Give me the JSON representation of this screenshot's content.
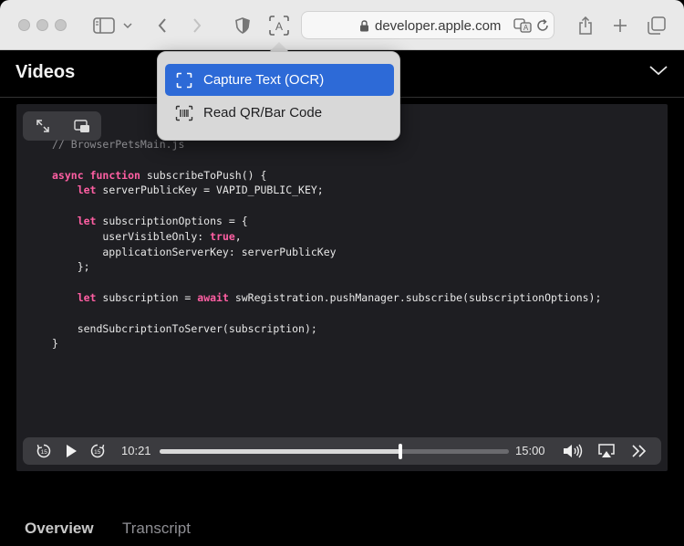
{
  "toolbar": {
    "url": "developer.apple.com"
  },
  "icons": {
    "sidebar": "sidebar-icon",
    "back": "chevron-left-icon",
    "forward": "chevron-right-icon",
    "shield": "shield-icon",
    "ocr": "live-text-icon",
    "lock": "lock-icon",
    "translate": "translate-icon",
    "reload": "reload-icon",
    "share": "share-icon",
    "new_tab": "plus-icon",
    "tabs": "tab-overview-icon"
  },
  "page": {
    "title": "Videos"
  },
  "code_lines": [
    {
      "parts": [
        {
          "t": "// BrowserPetsMain.js",
          "c": "cm"
        }
      ]
    },
    {
      "parts": [
        {
          "t": "",
          "c": ""
        }
      ]
    },
    {
      "parts": [
        {
          "t": "async",
          "c": "kw"
        },
        {
          "t": " ",
          "c": ""
        },
        {
          "t": "function",
          "c": "kw"
        },
        {
          "t": " subscribeToPush() {",
          "c": ""
        }
      ]
    },
    {
      "parts": [
        {
          "t": "    ",
          "c": ""
        },
        {
          "t": "let",
          "c": "kw"
        },
        {
          "t": " serverPublicKey = VAPID_PUBLIC_KEY;",
          "c": ""
        }
      ]
    },
    {
      "parts": [
        {
          "t": "",
          "c": ""
        }
      ]
    },
    {
      "parts": [
        {
          "t": "    ",
          "c": ""
        },
        {
          "t": "let",
          "c": "kw"
        },
        {
          "t": " subscriptionOptions = {",
          "c": ""
        }
      ]
    },
    {
      "parts": [
        {
          "t": "        userVisibleOnly: ",
          "c": ""
        },
        {
          "t": "true",
          "c": "kw"
        },
        {
          "t": ",",
          "c": ""
        }
      ]
    },
    {
      "parts": [
        {
          "t": "        applicationServerKey: serverPublicKey",
          "c": ""
        }
      ]
    },
    {
      "parts": [
        {
          "t": "    };",
          "c": ""
        }
      ]
    },
    {
      "parts": [
        {
          "t": "",
          "c": ""
        }
      ]
    },
    {
      "parts": [
        {
          "t": "    ",
          "c": ""
        },
        {
          "t": "let",
          "c": "kw"
        },
        {
          "t": " subscription = ",
          "c": ""
        },
        {
          "t": "await",
          "c": "kw"
        },
        {
          "t": " swRegistration.pushManager.subscribe(subscriptionOptions);",
          "c": ""
        }
      ]
    },
    {
      "parts": [
        {
          "t": "",
          "c": ""
        }
      ]
    },
    {
      "parts": [
        {
          "t": "    sendSubcriptionToServer(subscription);",
          "c": ""
        }
      ]
    },
    {
      "parts": [
        {
          "t": "}",
          "c": ""
        }
      ]
    }
  ],
  "player": {
    "current_time": "10:21",
    "duration": "15:00",
    "progress": 0.69,
    "skip_back_label": "15",
    "skip_forward_label": "15"
  },
  "tabs": {
    "overview": "Overview",
    "transcript": "Transcript"
  },
  "menu": {
    "capture_text": "Capture Text (OCR)",
    "read_code": "Read QR/Bar Code"
  },
  "colors": {
    "accent": "#2d6ad7",
    "keyword": "#ff5fa3"
  }
}
